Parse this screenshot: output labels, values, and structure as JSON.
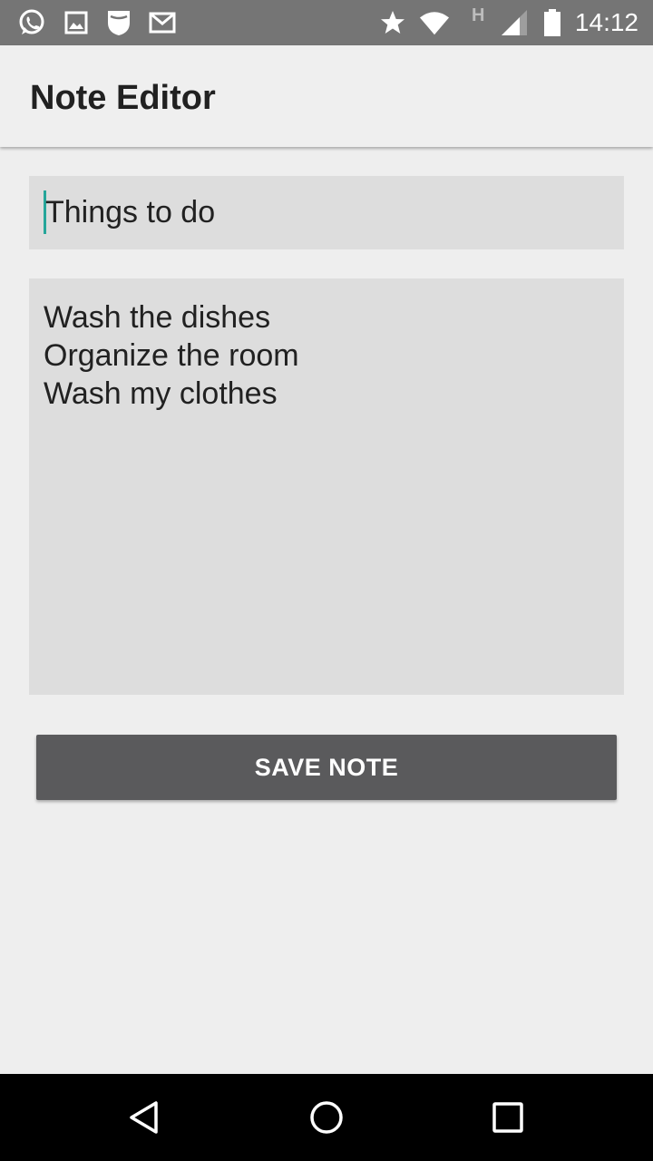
{
  "status_bar": {
    "time": "14:12",
    "network_label": "H",
    "icons": [
      "whatsapp-icon",
      "image-icon",
      "shield-icon",
      "gmail-icon",
      "star-icon",
      "wifi-icon",
      "signal-icon",
      "battery-icon"
    ]
  },
  "app_bar": {
    "title": "Note Editor"
  },
  "editor": {
    "title_value": "Things to do",
    "body_lines": [
      "Wash the dishes",
      "Organize the room",
      "Wash my clothes"
    ],
    "save_label": "SAVE NOTE"
  },
  "nav_bar": {
    "icons": [
      "back-icon",
      "home-icon",
      "recents-icon"
    ]
  },
  "colors": {
    "status_bar": "#757575",
    "app_bar": "#efefef",
    "field_bg": "#dddddd",
    "button_bg": "#5a5a5c",
    "cursor": "#26a69a"
  }
}
